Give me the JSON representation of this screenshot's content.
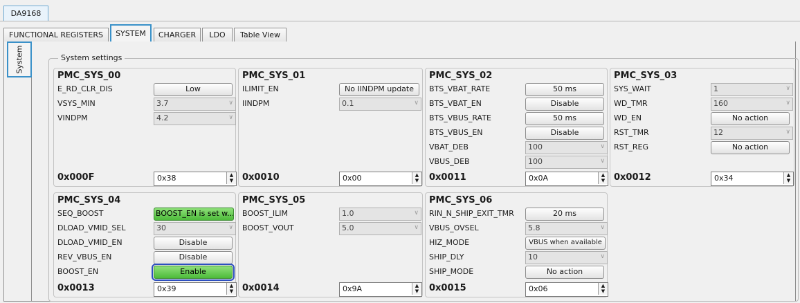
{
  "device_tab": "DA9168",
  "tabs": [
    {
      "label": "FUNCTIONAL REGISTERS"
    },
    {
      "label": "SYSTEM"
    },
    {
      "label": "CHARGER"
    },
    {
      "label": "LDO"
    },
    {
      "label": "Table View"
    }
  ],
  "side_tab": "System",
  "group_title": "System settings",
  "panels": {
    "sys00": {
      "title": "PMC_SYS_00",
      "rows": [
        {
          "label": "E_RD_CLR_DIS",
          "value": "Low"
        },
        {
          "label": "VSYS_MIN",
          "value": "3.7"
        },
        {
          "label": "VINDPM",
          "value": "4.2"
        }
      ],
      "address": "0x000F",
      "reg_value": "0x38"
    },
    "sys01": {
      "title": "PMC_SYS_01",
      "rows": [
        {
          "label": "ILIMIT_EN",
          "value": "No IINDPM update"
        },
        {
          "label": "IINDPM",
          "value": "0.1"
        }
      ],
      "address": "0x0010",
      "reg_value": "0x00"
    },
    "sys02": {
      "title": "PMC_SYS_02",
      "rows": [
        {
          "label": "BTS_VBAT_RATE",
          "value": "50 ms"
        },
        {
          "label": "BTS_VBAT_EN",
          "value": "Disable"
        },
        {
          "label": "BTS_VBUS_RATE",
          "value": "50 ms"
        },
        {
          "label": "BTS_VBUS_EN",
          "value": "Disable"
        },
        {
          "label": "VBAT_DEB",
          "value": "100"
        },
        {
          "label": "VBUS_DEB",
          "value": "100"
        }
      ],
      "address": "0x0011",
      "reg_value": "0x0A"
    },
    "sys03": {
      "title": "PMC_SYS_03",
      "rows": [
        {
          "label": "SYS_WAIT",
          "value": "1"
        },
        {
          "label": "WD_TMR",
          "value": "160"
        },
        {
          "label": "WD_EN",
          "value": "No action"
        },
        {
          "label": "RST_TMR",
          "value": "12"
        },
        {
          "label": "RST_REG",
          "value": "No action"
        }
      ],
      "address": "0x0012",
      "reg_value": "0x34"
    },
    "sys04": {
      "title": "PMC_SYS_04",
      "rows": [
        {
          "label": "SEQ_BOOST",
          "value": "BOOST_EN is set w..."
        },
        {
          "label": "DLOAD_VMID_SEL",
          "value": "30"
        },
        {
          "label": "DLOAD_VMID_EN",
          "value": "Disable"
        },
        {
          "label": "REV_VBUS_EN",
          "value": "Disable"
        },
        {
          "label": "BOOST_EN",
          "value": "Enable"
        }
      ],
      "address": "0x0013",
      "reg_value": "0x39"
    },
    "sys05": {
      "title": "PMC_SYS_05",
      "rows": [
        {
          "label": "BOOST_ILIM",
          "value": "1.0"
        },
        {
          "label": "BOOST_VOUT",
          "value": "5.0"
        }
      ],
      "address": "0x0014",
      "reg_value": "0x9A"
    },
    "sys06": {
      "title": "PMC_SYS_06",
      "rows": [
        {
          "label": "RIN_N_SHIP_EXIT_TMR",
          "value": "20 ms"
        },
        {
          "label": "VBUS_OVSEL",
          "value": "5.8"
        },
        {
          "label": "HIZ_MODE",
          "value": "VBUS when available"
        },
        {
          "label": "SHIP_DLY",
          "value": "10"
        },
        {
          "label": "SHIP_MODE",
          "value": "No action"
        }
      ],
      "address": "0x0015",
      "reg_value": "0x06"
    }
  },
  "colors": {
    "accent_border": "#3a91c9",
    "green_button": "#5cc447",
    "focus_outline": "#2d4fbf"
  }
}
